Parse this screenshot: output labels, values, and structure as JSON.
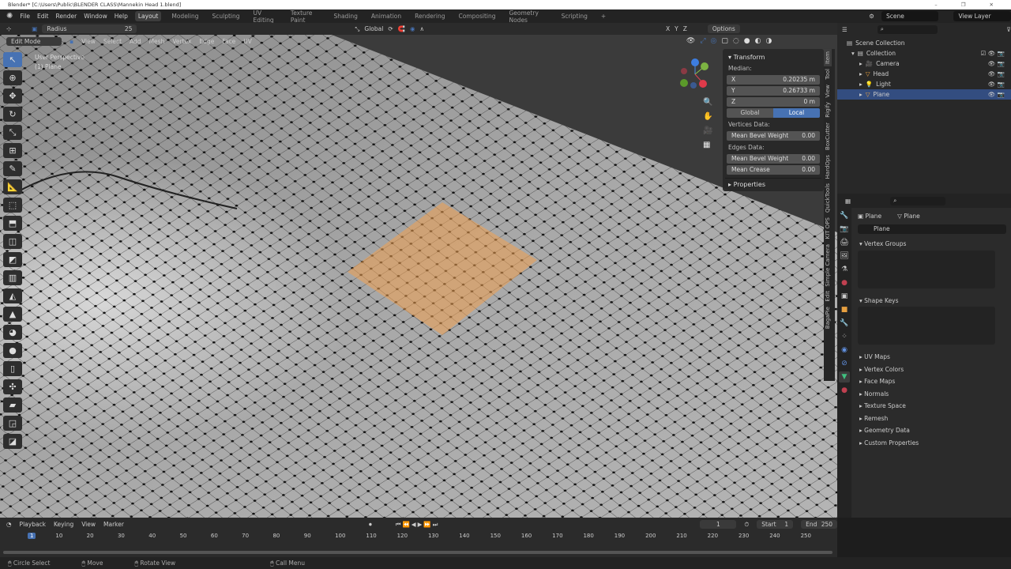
{
  "window": {
    "title": "Blender* [C:\\Users\\Public\\BLENDER CLASS\\Mannekin Head 1.blend]",
    "controls": "– ❐ ✕"
  },
  "menu": {
    "items": [
      "File",
      "Edit",
      "Render",
      "Window",
      "Help"
    ],
    "workspaces": [
      "Layout",
      "Modeling",
      "Sculpting",
      "UV Editing",
      "Texture Paint",
      "Shading",
      "Animation",
      "Rendering",
      "Compositing",
      "Geometry Nodes",
      "Scripting",
      "+"
    ],
    "scene": "Scene",
    "view_layer": "View Layer"
  },
  "tool_header": {
    "radius_label": "Radius",
    "radius_value": "25",
    "orientation": "Global",
    "options": "Options",
    "axes": [
      "X",
      "Y",
      "Z"
    ]
  },
  "view_header": {
    "mode": "Edit Mode",
    "items": [
      "View",
      "Select",
      "Add",
      "Mesh",
      "Vertex",
      "Edge",
      "Face",
      "UV"
    ]
  },
  "viewport": {
    "perspective": "User Perspective",
    "object": "(1) Plane",
    "accent": "#f0a050"
  },
  "npanel": {
    "transform": "Transform",
    "median": "Median:",
    "x_label": "X",
    "x": "0.20235 m",
    "y_label": "Y",
    "y": "0.26733 m",
    "z_label": "Z",
    "z": "0 m",
    "global": "Global",
    "local": "Local",
    "vertices_data": "Vertices Data:",
    "v_bevel_label": "Mean Bevel Weight",
    "v_bevel": "0.00",
    "edges_data": "Edges Data:",
    "e_bevel_label": "Mean Bevel Weight",
    "e_bevel": "0.00",
    "crease_label": "Mean Crease",
    "crease": "0.00",
    "properties": "Properties"
  },
  "ntabs": [
    "Item",
    "Tool",
    "View",
    "Rigify",
    "BoxCutter",
    "HardOps",
    "QuickTools",
    "KIT OPS",
    "Simple Camera",
    "Edit",
    "BagaPie"
  ],
  "outliner": {
    "scene_collection": "Scene Collection",
    "collection": "Collection",
    "objects": [
      "Camera",
      "Head",
      "Light",
      "Plane"
    ]
  },
  "properties": {
    "object": "Plane",
    "mesh": "Plane",
    "data_name": "Plane",
    "sections_open": [
      "Vertex Groups",
      "Shape Keys"
    ],
    "sections": [
      "UV Maps",
      "Vertex Colors",
      "Face Maps",
      "Normals",
      "Texture Space",
      "Remesh",
      "Geometry Data",
      "Custom Properties"
    ]
  },
  "timeline": {
    "menus": [
      "Playback",
      "Keying",
      "View",
      "Marker"
    ],
    "current": "1",
    "start_label": "Start",
    "start": "1",
    "end_label": "End",
    "end": "250",
    "ticks": [
      "1",
      "10",
      "20",
      "30",
      "40",
      "50",
      "60",
      "70",
      "80",
      "90",
      "100",
      "110",
      "120",
      "130",
      "140",
      "150",
      "160",
      "170",
      "180",
      "190",
      "200",
      "210",
      "220",
      "230",
      "240",
      "250"
    ]
  },
  "status": [
    "Circle Select",
    "Move",
    "Rotate View",
    "Call Menu"
  ]
}
